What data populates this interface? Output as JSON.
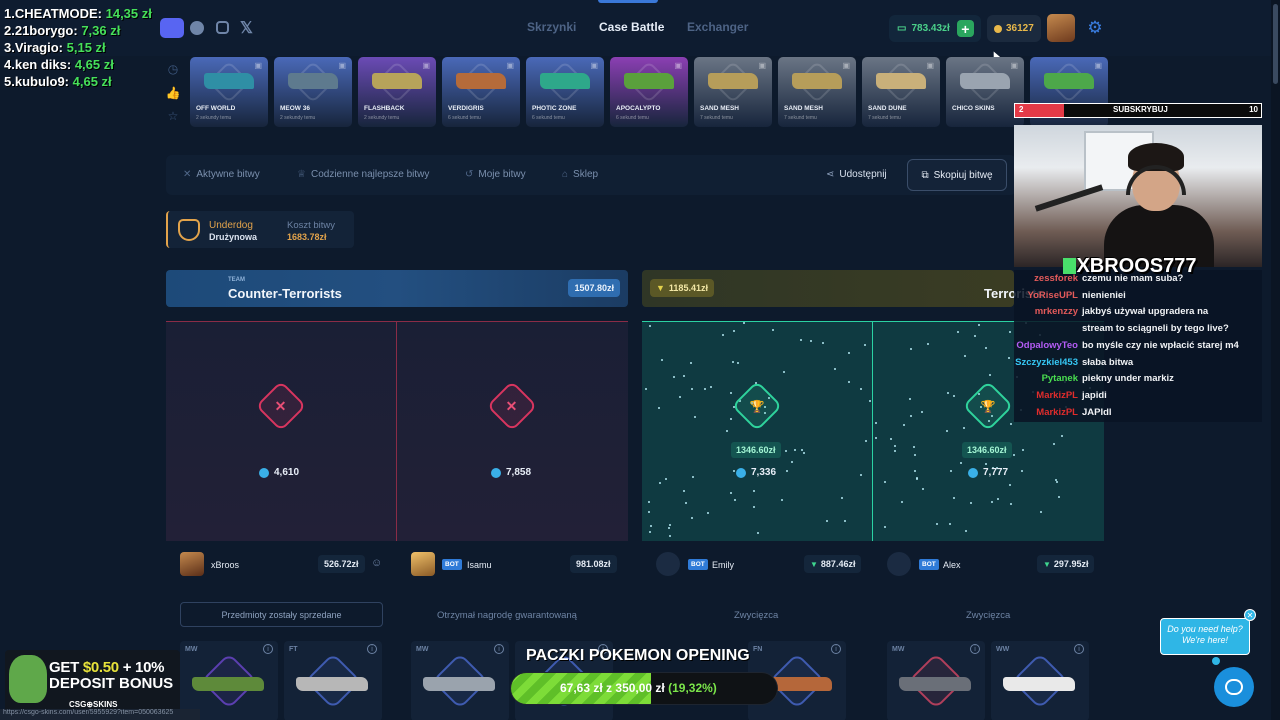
{
  "leaderboard": [
    {
      "rank": "1.",
      "name": "CHEATMODE:",
      "amount": "14,35 zł"
    },
    {
      "rank": "2.",
      "name": "21borygo:",
      "amount": "7,36 zł"
    },
    {
      "rank": "3.",
      "name": "Viragio:",
      "amount": "5,15 zł"
    },
    {
      "rank": "4.",
      "name": "ken diks:",
      "amount": "4,65 zł"
    },
    {
      "rank": "5.",
      "name": "kubulo9:",
      "amount": "4,65 zł"
    }
  ],
  "nav": {
    "cases": "Skrzynki",
    "case_battle": "Case Battle",
    "exchanger": "Exchanger"
  },
  "header": {
    "balance": "783.43zł",
    "plus": "+",
    "coins": "36127",
    "settings": "⚙"
  },
  "drop_side_icons": [
    "◷",
    "👍",
    "☆"
  ],
  "drops": [
    {
      "name": "OFF WORLD",
      "time": "2 sekundy temu",
      "color": "#4a69b8",
      "gun": "#2f8fa5"
    },
    {
      "name": "MEOW 36",
      "time": "2 sekundy temu",
      "color": "#4a69b8",
      "gun": "#5e7a8e"
    },
    {
      "name": "FLASHBACK",
      "time": "2 sekundy temu",
      "color": "#6b4bb5",
      "gun": "#b7a35a"
    },
    {
      "name": "VERDIGRIS",
      "time": "6 sekund temu",
      "color": "#4a69b8",
      "gun": "#b56b3a"
    },
    {
      "name": "PHOTIC ZONE",
      "time": "6 sekund temu",
      "color": "#4a69b8",
      "gun": "#2ea88a"
    },
    {
      "name": "APOCALYPTO",
      "time": "6 sekund temu",
      "color": "#8b3fb3",
      "gun": "#5aa03c"
    },
    {
      "name": "SAND MESH",
      "time": "7 sekund temu",
      "color": "#6a7585",
      "gun": "#b69d5a"
    },
    {
      "name": "SAND MESH",
      "time": "7 sekund temu",
      "color": "#6a7585",
      "gun": "#b69d5a"
    },
    {
      "name": "SAND DUNE",
      "time": "7 sekund temu",
      "color": "#6a7585",
      "gun": "#c9b07a"
    },
    {
      "name": "CHICO SKINS",
      "time": "",
      "color": "#6a7585",
      "gun": "#9aa4b0"
    },
    {
      "name": "",
      "time": "",
      "color": "#4a69b8",
      "gun": "#4da84a"
    }
  ],
  "menu": {
    "active": "Aktywne bitwy",
    "daily_best": "Codzienne najlepsze bitwy",
    "mine": "Moje bitwy",
    "shop": "Sklep",
    "share": "Udostępnij",
    "copy": "Skopiuj bitwę"
  },
  "mode": {
    "name": "Underdog",
    "type": "Drużynowa",
    "cost_label": "Koszt bitwy",
    "cost": "1683.78zł"
  },
  "teams": {
    "ct": {
      "label": "TEAM",
      "name": "Counter-Terrorists",
      "value": "1507.80zł"
    },
    "t": {
      "name": "Terrorists",
      "value": "1185.41zł"
    }
  },
  "slots": [
    {
      "result": "lose",
      "symbol": "✕",
      "prize": "",
      "score": "4,610"
    },
    {
      "result": "lose",
      "symbol": "✕",
      "prize": "",
      "score": "7,858"
    },
    {
      "result": "win",
      "symbol": "🏆",
      "prize": "1346.60zł",
      "score": "7,336"
    },
    {
      "result": "win",
      "symbol": "🏆",
      "prize": "1346.60zł",
      "score": "7,777"
    }
  ],
  "players": [
    {
      "name": "xBroos",
      "bot": "",
      "value": "526.72zł",
      "arrow": ""
    },
    {
      "name": "Isamu",
      "bot": "BOT",
      "value": "981.08zł",
      "arrow": ""
    },
    {
      "name": "Emily",
      "bot": "BOT",
      "value": "887.46zł",
      "arrow": "▼"
    },
    {
      "name": "Alex",
      "bot": "BOT",
      "value": "297.95zł",
      "arrow": "▼"
    }
  ],
  "status": {
    "sold": "Przedmioty zostały sprzedane",
    "guaranteed": "Otrzymał nagrodę gwarantowaną",
    "winner1": "Zwycięzca",
    "winner2": "Zwycięzca"
  },
  "items": [
    {
      "ext": "MW",
      "hex": "#5b3fb0",
      "gun": "#5e8a3a"
    },
    {
      "ext": "FT",
      "hex": "#3f5bb0",
      "gun": "#b7b7b7"
    },
    {
      "ext": "MW",
      "hex": "#3f5bb0",
      "gun": "#9aa3ad"
    },
    {
      "ext": "",
      "hex": "#3f5bb0",
      "gun": "#8a7a5a"
    },
    {
      "ext": "FN",
      "hex": "#3f5bb0",
      "gun": "#b5673a"
    },
    {
      "ext": "MW",
      "hex": "#b03f5b",
      "gun": "#6a6f78"
    },
    {
      "ext": "WW",
      "hex": "#3f5bb0",
      "gun": "#e9e9e9"
    }
  ],
  "stream": {
    "sub_start": "2",
    "sub_label": "SUBSKRYBUJ",
    "sub_goal": "10",
    "sub_progress": 0.2,
    "tag": "XBROOS777",
    "chat": [
      {
        "user": "zessforek",
        "color": "#e25a5a",
        "msg": "czemu nie mam suba?"
      },
      {
        "user": "YoRiseUPL",
        "color": "#e25a5a",
        "msg": "nienieniei"
      },
      {
        "user": "mrkenzzy",
        "color": "#e25a5a",
        "msg": "jakbyś używał upgradera na"
      },
      {
        "user": "",
        "color": "#e25a5a",
        "msg": "stream to sciągneli by tego live?"
      },
      {
        "user": "OdpalowyTeo",
        "color": "#b45cf5",
        "msg": "bo myśle czy nie wpłacić starej m4"
      },
      {
        "user": "Szczyzkiel453",
        "color": "#36c8f5",
        "msg": "słaba bitwa"
      },
      {
        "user": "Pytanek",
        "color": "#4ade50",
        "msg": "piekny under markiz"
      },
      {
        "user": "MarkizPL",
        "color": "#e02c2c",
        "msg": "japidi"
      },
      {
        "user": "MarkizPL",
        "color": "#e02c2c",
        "msg": "JAPIdl"
      }
    ]
  },
  "promo": {
    "line1a": "GET",
    "line1b": "$0.50",
    "line1c": "+ 10%",
    "line2": "DEPOSIT BONUS",
    "brand": "CSG⊕SKINS"
  },
  "url": "https://csgo-skins.com/user/5955929?item=050063625",
  "goal": {
    "title": "PACZKI POKEMON OPENING",
    "current": "67,63 zł",
    "sep": "z",
    "target": "350,00 zł",
    "pct": "(19,32%)",
    "progress": 0.1932
  },
  "help": {
    "line1": "Do you need help?",
    "line2": "We're here!",
    "close": "✕"
  }
}
